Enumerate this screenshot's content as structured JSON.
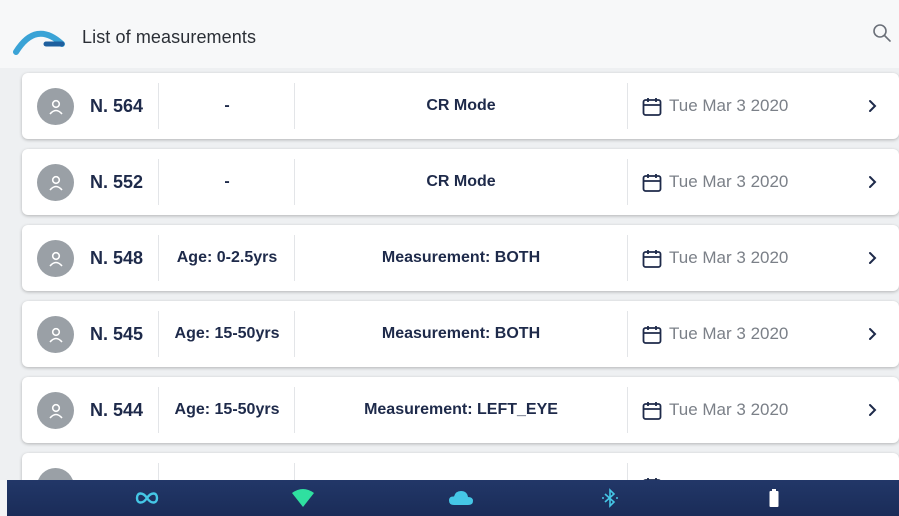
{
  "header": {
    "title": "List of measurements",
    "logo_icon": "brand-arc-logo",
    "search_icon": "search-icon"
  },
  "measurements": [
    {
      "number": "N. 564",
      "age": "-",
      "mode": "CR Mode",
      "date": "Tue Mar 3 2020"
    },
    {
      "number": "N. 552",
      "age": "-",
      "mode": "CR Mode",
      "date": "Tue Mar 3 2020"
    },
    {
      "number": "N. 548",
      "age": "Age: 0-2.5yrs",
      "mode": "Measurement: BOTH",
      "date": "Tue Mar 3 2020"
    },
    {
      "number": "N. 545",
      "age": "Age: 15-50yrs",
      "mode": "Measurement: BOTH",
      "date": "Tue Mar 3 2020"
    },
    {
      "number": "N. 544",
      "age": "Age: 15-50yrs",
      "mode": "Measurement: LEFT_EYE",
      "date": "Tue Mar 3 2020"
    }
  ],
  "status_bar": {
    "icons": [
      "infinity-link-icon",
      "wifi-icon",
      "cloud-icon",
      "bluetooth-icon",
      "battery-icon"
    ]
  },
  "colors": {
    "brand_accent": "#3aa3d6",
    "status_icon": "#45c7e6",
    "bottom_bar": "#1f3363"
  }
}
